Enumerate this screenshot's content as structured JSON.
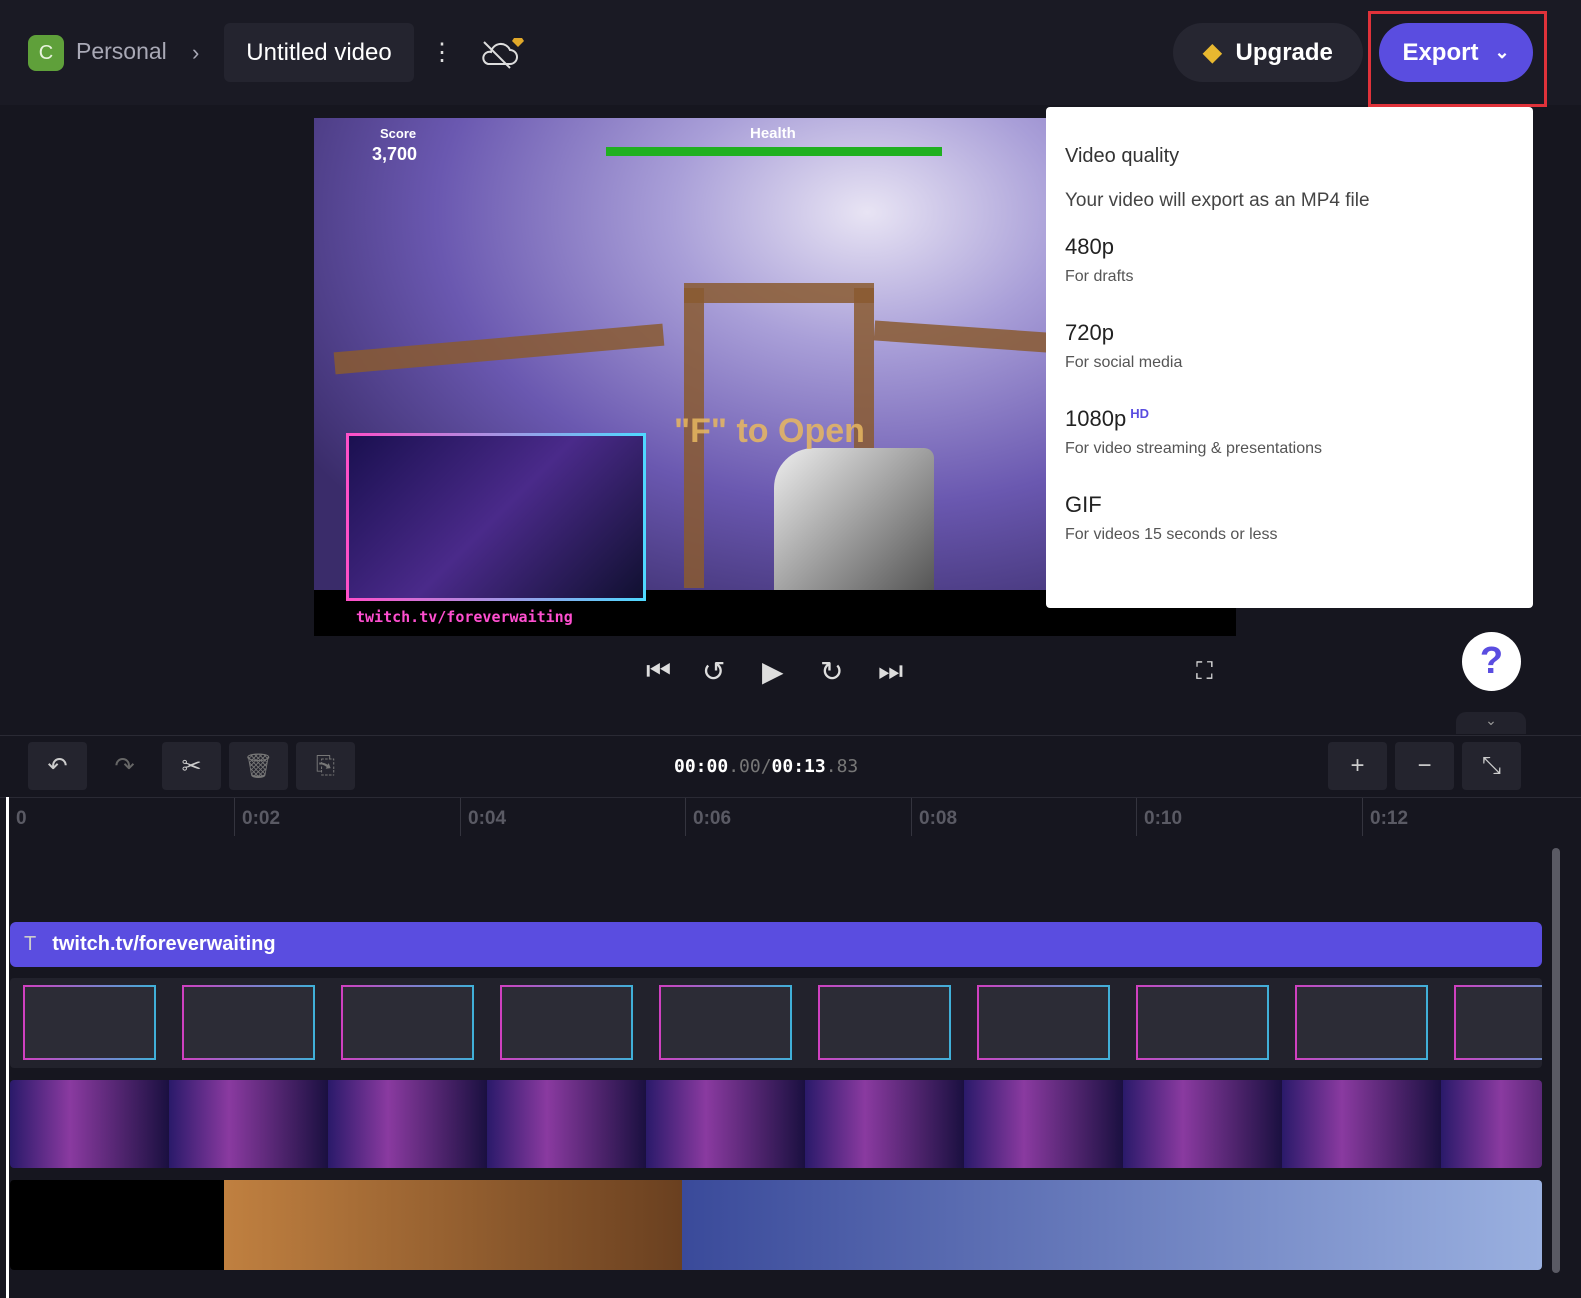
{
  "header": {
    "workspace_initial": "C",
    "workspace": "Personal",
    "project_title": "Untitled video",
    "upgrade_label": "Upgrade",
    "export_label": "Export"
  },
  "preview": {
    "score_label": "Score",
    "score_value": "3,700",
    "health_label": "Health",
    "health_fraction": 1.0,
    "prompt": "\"F\" to Open",
    "overlay_text": "twitch.tv/foreverwaiting"
  },
  "export_menu": {
    "title": "Video quality",
    "subtitle": "Your video will export as an MP4 file",
    "options": [
      {
        "label": "480p",
        "desc": "For drafts"
      },
      {
        "label": "720p",
        "desc": "For social media"
      },
      {
        "label": "1080p",
        "badge": "HD",
        "desc": "For video streaming & presentations"
      },
      {
        "label": "GIF",
        "desc": "For videos 15 seconds or less"
      }
    ]
  },
  "player": {
    "help": "?"
  },
  "timeline": {
    "current_main": "00:00",
    "current_frac": ".00",
    "sep": "/",
    "total_main": "00:13",
    "total_frac": ".83",
    "ticks": [
      "0",
      "0:02",
      "0:04",
      "0:06",
      "0:08",
      "0:10",
      "0:12"
    ],
    "text_track": "twitch.tv/foreverwaiting",
    "text_icon": "T"
  },
  "colors": {
    "accent": "#5a4de0",
    "highlight": "#e0323a",
    "background": "#16161f"
  }
}
